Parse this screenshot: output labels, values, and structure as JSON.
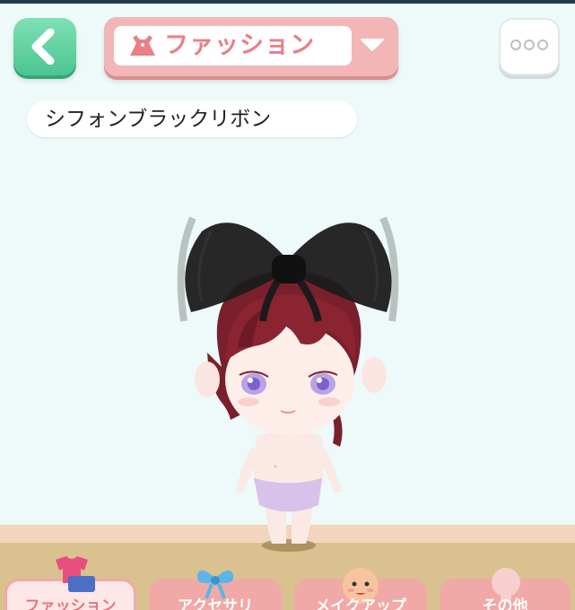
{
  "header": {
    "category_label": "ファッション"
  },
  "item": {
    "name": "シフォンブラックリボン"
  },
  "tabs": [
    {
      "label": "ファッション",
      "active": true
    },
    {
      "label": "アクセサリ",
      "active": false
    },
    {
      "label": "メイクアップ",
      "active": false
    },
    {
      "label": "その他",
      "active": false
    }
  ],
  "icons": [
    "back-arrow-icon",
    "dress-icon",
    "dropdown-arrow-icon",
    "more-dots-icon",
    "clothes-icon",
    "ribbon-icon",
    "face-icon",
    "silhouette-icon"
  ],
  "colors": {
    "background": "#eefaf9",
    "back_button": "#4cc592",
    "category_accent": "#ea7f85",
    "category_frame": "#f2b6b6",
    "tab_inactive": "#f0a9a6",
    "floor": "#d9c28f"
  }
}
